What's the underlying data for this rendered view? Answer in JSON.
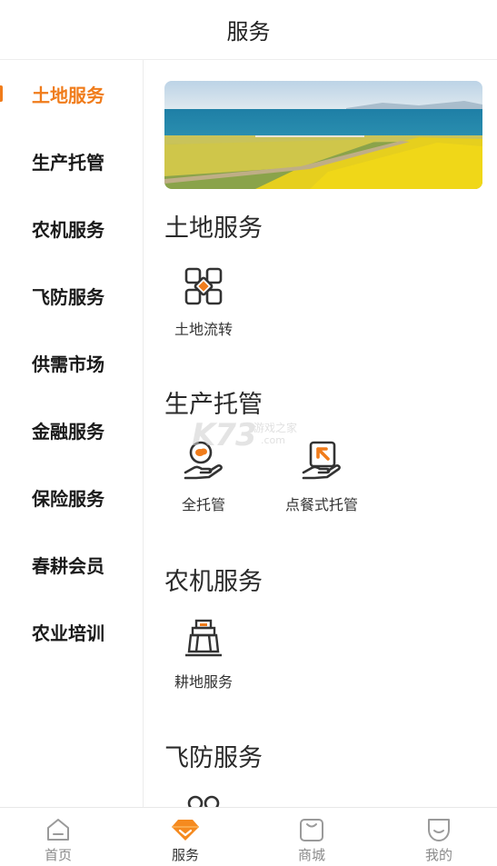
{
  "header": {
    "title": "服务"
  },
  "sidebar": {
    "active_index": 0,
    "items": [
      {
        "label": "土地服务"
      },
      {
        "label": "生产托管"
      },
      {
        "label": "农机服务"
      },
      {
        "label": "飞防服务"
      },
      {
        "label": "供需市场"
      },
      {
        "label": "金融服务"
      },
      {
        "label": "保险服务"
      },
      {
        "label": "春耕会员"
      },
      {
        "label": "农业培训"
      }
    ]
  },
  "content": {
    "banner": {
      "icon": "landscape-image"
    },
    "sections": [
      {
        "title": "土地服务",
        "items": [
          {
            "label": "土地流转",
            "icon": "land-transfer-icon"
          }
        ]
      },
      {
        "title": "生产托管",
        "items": [
          {
            "label": "全托管",
            "icon": "full-custody-icon"
          },
          {
            "label": "点餐式托管",
            "icon": "menu-custody-icon"
          }
        ]
      },
      {
        "title": "农机服务",
        "items": [
          {
            "label": "耕地服务",
            "icon": "tractor-icon"
          }
        ]
      },
      {
        "title": "飞防服务",
        "items": []
      }
    ]
  },
  "watermark": {
    "big": "K73",
    "small": "游戏之家",
    "domain": ".com"
  },
  "tabbar": {
    "active_index": 1,
    "items": [
      {
        "label": "首页",
        "icon": "home-icon"
      },
      {
        "label": "服务",
        "icon": "diamond-icon"
      },
      {
        "label": "商城",
        "icon": "shop-icon"
      },
      {
        "label": "我的",
        "icon": "profile-icon"
      }
    ]
  },
  "colors": {
    "accent": "#f07c1b",
    "text": "#222222",
    "muted": "#8a8a8a",
    "divider": "#eeeeee"
  }
}
